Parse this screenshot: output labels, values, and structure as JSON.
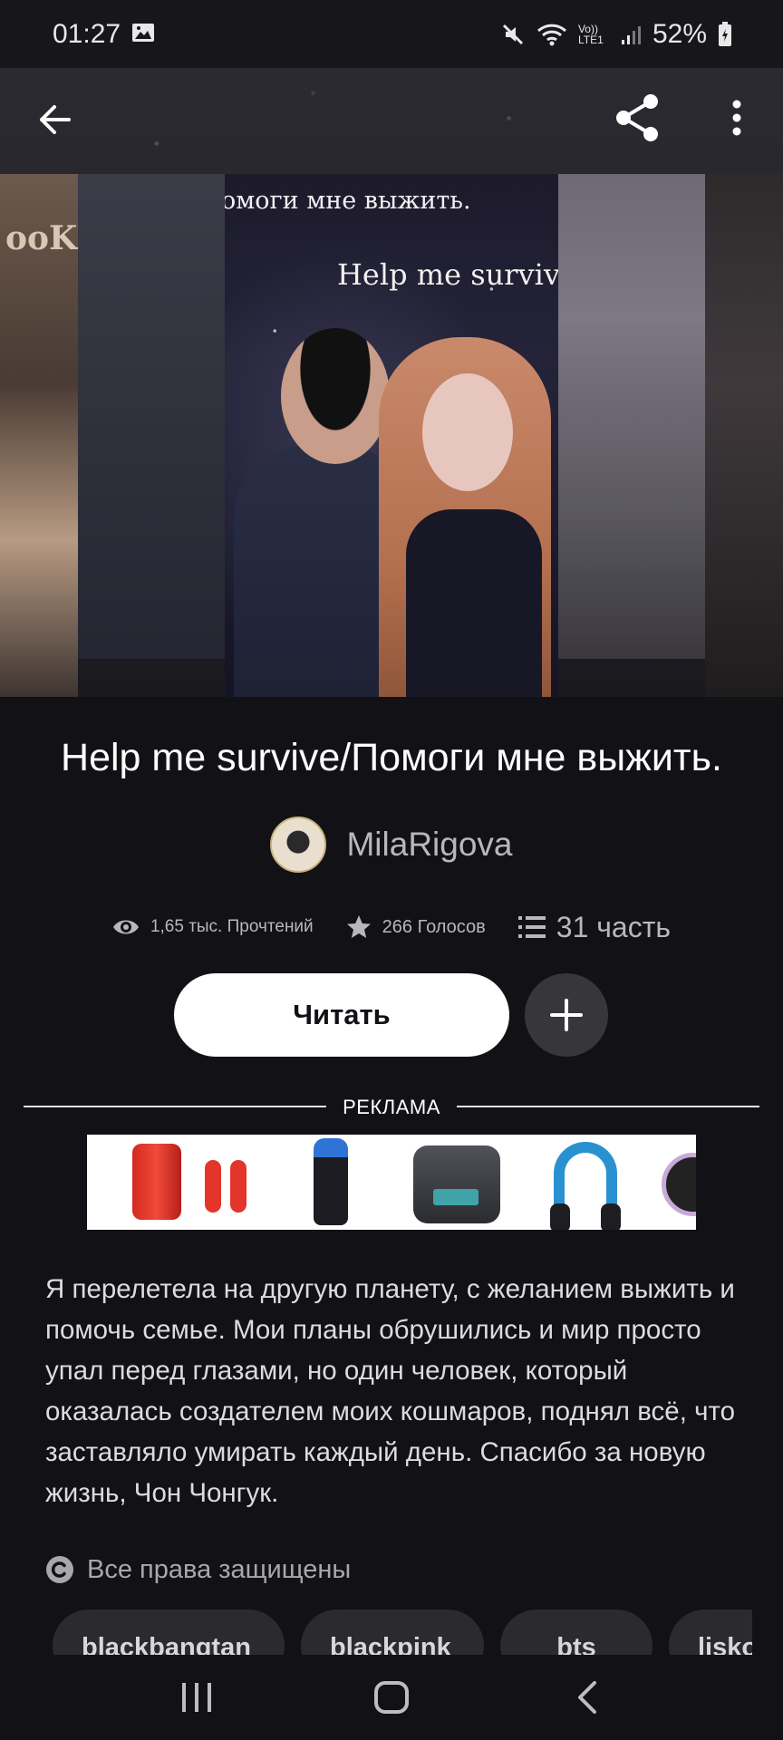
{
  "status_bar": {
    "time": "01:27",
    "network": "Vo)) LTE1",
    "battery": "52%"
  },
  "toolbar": {
    "back_icon": "arrow-left-icon",
    "share_icon": "share-icon",
    "more_icon": "more-vertical-icon"
  },
  "cover": {
    "line1": "омоги мне выжить.",
    "line2": "Help me survive",
    "side_text": "ooK"
  },
  "story": {
    "title": "Help me survive/Помоги мне выжить.",
    "author": "MilaRigova"
  },
  "stats": {
    "reads": "1,65 тыс. Прочтений",
    "votes": "266 Голосов",
    "parts": "31 часть"
  },
  "actions": {
    "read_label": "Читать",
    "add_icon": "plus-icon"
  },
  "ad": {
    "label": "РЕКЛАМА"
  },
  "description": "Я перелетела на другую планету, с желанием выжить и помочь семье. Мои планы обрушились и мир просто упал перед глазами, но один человек, который оказалась создателем моих кошмаров, поднял всё, что заставляло умирать каждый день. Спасибо за новую жизнь, Чон Чонгук.",
  "rights": {
    "text": "Все права защищены",
    "icon": "copyright-icon"
  },
  "tags": [
    "blackbangtan",
    "blackpink",
    "bts",
    "lisko"
  ],
  "colors": {
    "background": "#121115",
    "primary_button": "#ffffff",
    "secondary_button": "#37363b",
    "muted_text": "#b8b8bc"
  }
}
